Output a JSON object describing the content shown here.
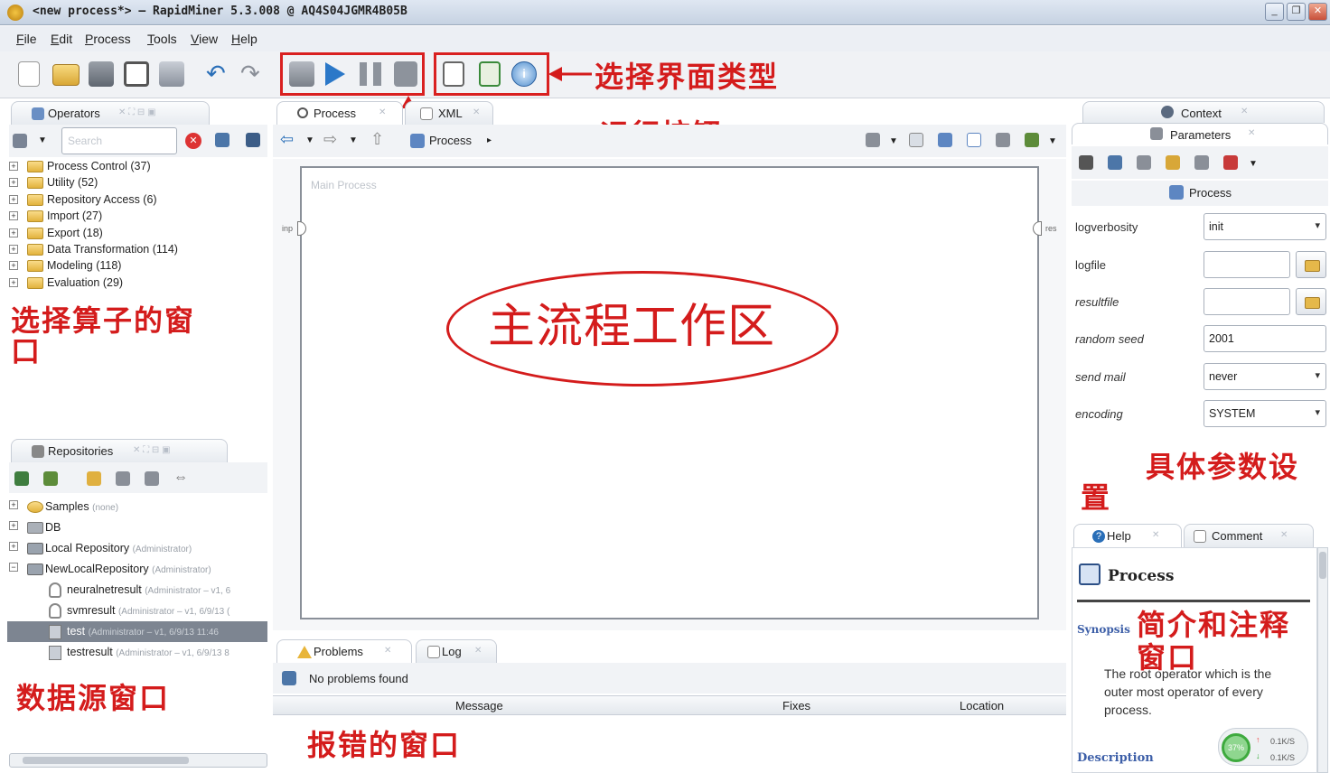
{
  "window": {
    "title": "<new process*> – RapidMiner 5.3.008 @ AQ4S04JGMR4B05B",
    "minimize": "_",
    "restore": "❐",
    "close": "✕"
  },
  "menu": [
    "File",
    "Edit",
    "Process",
    "Tools",
    "View",
    "Help"
  ],
  "annotations": {
    "view_type": "选择界面类型",
    "run_buttons": "运行按钮",
    "main_area": "主流程工作区",
    "operators": "选择算子的窗口",
    "repositories": "数据源窗口",
    "errors": "报错的窗口",
    "parameters": "具体参数设置",
    "help": "简介和注释窗口"
  },
  "operators": {
    "tab": "Operators",
    "search_placeholder": "Search",
    "tree": [
      "Process Control (37)",
      "Utility (52)",
      "Repository Access (6)",
      "Import (27)",
      "Export (18)",
      "Data Transformation (114)",
      "Modeling (118)",
      "Evaluation (29)"
    ]
  },
  "repositories": {
    "tab": "Repositories",
    "items": [
      {
        "name": "Samples",
        "meta": "(none)"
      },
      {
        "name": "DB",
        "meta": ""
      },
      {
        "name": "Local Repository",
        "meta": "(Administrator)"
      },
      {
        "name": "NewLocalRepository",
        "meta": "(Administrator)"
      }
    ],
    "children": [
      {
        "name": "neuralnetresult",
        "meta": "(Administrator – v1, 6"
      },
      {
        "name": "svmresult",
        "meta": "(Administrator – v1, 6/9/13 ("
      },
      {
        "name": "test",
        "meta": "(Administrator – v1, 6/9/13 11:46"
      },
      {
        "name": "testresult",
        "meta": "(Administrator – v1, 6/9/13 8"
      }
    ]
  },
  "process": {
    "tab": "Process",
    "xml_tab": "XML",
    "breadcrumb": "Process",
    "canvas_label": "Main Process",
    "port_in": "inp",
    "port_out": "res"
  },
  "problems": {
    "tab": "Problems",
    "log_tab": "Log",
    "status": "No problems found",
    "columns": [
      "Message",
      "Fixes",
      "Location"
    ]
  },
  "context": {
    "tab": "Context"
  },
  "parameters": {
    "tab": "Parameters",
    "operator": "Process",
    "rows": [
      {
        "label": "logverbosity",
        "value": "init"
      },
      {
        "label": "logfile",
        "value": ""
      },
      {
        "label": "resultfile",
        "value": ""
      },
      {
        "label": "random seed",
        "value": "2001"
      },
      {
        "label": "send mail",
        "value": "never"
      },
      {
        "label": "encoding",
        "value": "SYSTEM"
      }
    ]
  },
  "help": {
    "tab": "Help",
    "comment_tab": "Comment",
    "title": "Process",
    "synopsis_label": "Synopsis",
    "synopsis": "The root operator which is the outer most operator of every process.",
    "description_label": "Description",
    "memory_pct": "37%",
    "net_up": "0.1K/S",
    "net_down": "0.1K/S"
  }
}
